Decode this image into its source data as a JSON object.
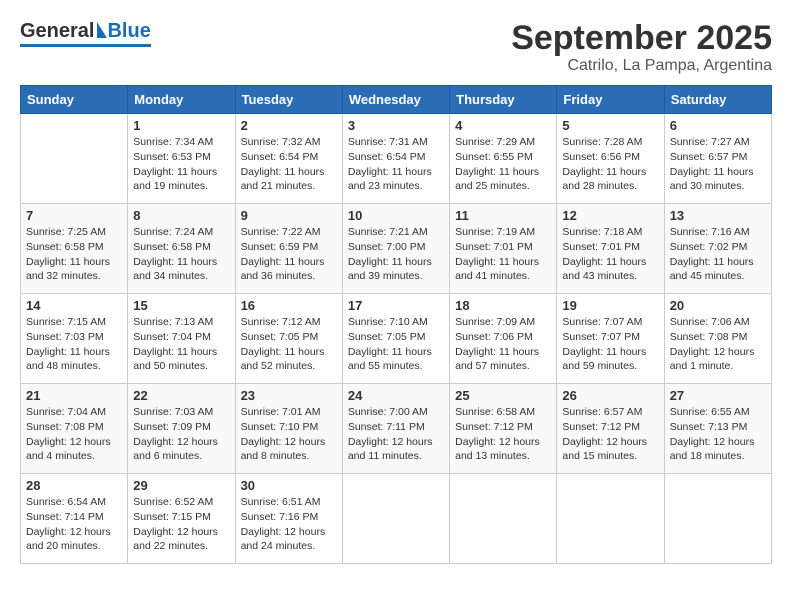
{
  "header": {
    "logo_general": "General",
    "logo_blue": "Blue",
    "title": "September 2025",
    "subtitle": "Catrilo, La Pampa, Argentina"
  },
  "days_of_week": [
    "Sunday",
    "Monday",
    "Tuesday",
    "Wednesday",
    "Thursday",
    "Friday",
    "Saturday"
  ],
  "weeks": [
    [
      {
        "day": "",
        "info": ""
      },
      {
        "day": "1",
        "info": "Sunrise: 7:34 AM\nSunset: 6:53 PM\nDaylight: 11 hours\nand 19 minutes."
      },
      {
        "day": "2",
        "info": "Sunrise: 7:32 AM\nSunset: 6:54 PM\nDaylight: 11 hours\nand 21 minutes."
      },
      {
        "day": "3",
        "info": "Sunrise: 7:31 AM\nSunset: 6:54 PM\nDaylight: 11 hours\nand 23 minutes."
      },
      {
        "day": "4",
        "info": "Sunrise: 7:29 AM\nSunset: 6:55 PM\nDaylight: 11 hours\nand 25 minutes."
      },
      {
        "day": "5",
        "info": "Sunrise: 7:28 AM\nSunset: 6:56 PM\nDaylight: 11 hours\nand 28 minutes."
      },
      {
        "day": "6",
        "info": "Sunrise: 7:27 AM\nSunset: 6:57 PM\nDaylight: 11 hours\nand 30 minutes."
      }
    ],
    [
      {
        "day": "7",
        "info": "Sunrise: 7:25 AM\nSunset: 6:58 PM\nDaylight: 11 hours\nand 32 minutes."
      },
      {
        "day": "8",
        "info": "Sunrise: 7:24 AM\nSunset: 6:58 PM\nDaylight: 11 hours\nand 34 minutes."
      },
      {
        "day": "9",
        "info": "Sunrise: 7:22 AM\nSunset: 6:59 PM\nDaylight: 11 hours\nand 36 minutes."
      },
      {
        "day": "10",
        "info": "Sunrise: 7:21 AM\nSunset: 7:00 PM\nDaylight: 11 hours\nand 39 minutes."
      },
      {
        "day": "11",
        "info": "Sunrise: 7:19 AM\nSunset: 7:01 PM\nDaylight: 11 hours\nand 41 minutes."
      },
      {
        "day": "12",
        "info": "Sunrise: 7:18 AM\nSunset: 7:01 PM\nDaylight: 11 hours\nand 43 minutes."
      },
      {
        "day": "13",
        "info": "Sunrise: 7:16 AM\nSunset: 7:02 PM\nDaylight: 11 hours\nand 45 minutes."
      }
    ],
    [
      {
        "day": "14",
        "info": "Sunrise: 7:15 AM\nSunset: 7:03 PM\nDaylight: 11 hours\nand 48 minutes."
      },
      {
        "day": "15",
        "info": "Sunrise: 7:13 AM\nSunset: 7:04 PM\nDaylight: 11 hours\nand 50 minutes."
      },
      {
        "day": "16",
        "info": "Sunrise: 7:12 AM\nSunset: 7:05 PM\nDaylight: 11 hours\nand 52 minutes."
      },
      {
        "day": "17",
        "info": "Sunrise: 7:10 AM\nSunset: 7:05 PM\nDaylight: 11 hours\nand 55 minutes."
      },
      {
        "day": "18",
        "info": "Sunrise: 7:09 AM\nSunset: 7:06 PM\nDaylight: 11 hours\nand 57 minutes."
      },
      {
        "day": "19",
        "info": "Sunrise: 7:07 AM\nSunset: 7:07 PM\nDaylight: 11 hours\nand 59 minutes."
      },
      {
        "day": "20",
        "info": "Sunrise: 7:06 AM\nSunset: 7:08 PM\nDaylight: 12 hours\nand 1 minute."
      }
    ],
    [
      {
        "day": "21",
        "info": "Sunrise: 7:04 AM\nSunset: 7:08 PM\nDaylight: 12 hours\nand 4 minutes."
      },
      {
        "day": "22",
        "info": "Sunrise: 7:03 AM\nSunset: 7:09 PM\nDaylight: 12 hours\nand 6 minutes."
      },
      {
        "day": "23",
        "info": "Sunrise: 7:01 AM\nSunset: 7:10 PM\nDaylight: 12 hours\nand 8 minutes."
      },
      {
        "day": "24",
        "info": "Sunrise: 7:00 AM\nSunset: 7:11 PM\nDaylight: 12 hours\nand 11 minutes."
      },
      {
        "day": "25",
        "info": "Sunrise: 6:58 AM\nSunset: 7:12 PM\nDaylight: 12 hours\nand 13 minutes."
      },
      {
        "day": "26",
        "info": "Sunrise: 6:57 AM\nSunset: 7:12 PM\nDaylight: 12 hours\nand 15 minutes."
      },
      {
        "day": "27",
        "info": "Sunrise: 6:55 AM\nSunset: 7:13 PM\nDaylight: 12 hours\nand 18 minutes."
      }
    ],
    [
      {
        "day": "28",
        "info": "Sunrise: 6:54 AM\nSunset: 7:14 PM\nDaylight: 12 hours\nand 20 minutes."
      },
      {
        "day": "29",
        "info": "Sunrise: 6:52 AM\nSunset: 7:15 PM\nDaylight: 12 hours\nand 22 minutes."
      },
      {
        "day": "30",
        "info": "Sunrise: 6:51 AM\nSunset: 7:16 PM\nDaylight: 12 hours\nand 24 minutes."
      },
      {
        "day": "",
        "info": ""
      },
      {
        "day": "",
        "info": ""
      },
      {
        "day": "",
        "info": ""
      },
      {
        "day": "",
        "info": ""
      }
    ]
  ]
}
